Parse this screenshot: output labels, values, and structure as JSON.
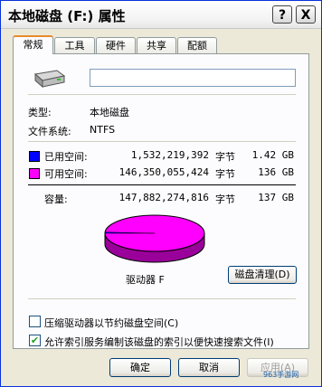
{
  "window": {
    "title": "本地磁盘 (F:) 属性",
    "help_label": "?",
    "close_label": "X"
  },
  "tabs": [
    {
      "label": "常规",
      "active": true
    },
    {
      "label": "工具",
      "active": false
    },
    {
      "label": "硬件",
      "active": false
    },
    {
      "label": "共享",
      "active": false
    },
    {
      "label": "配额",
      "active": false
    }
  ],
  "general": {
    "name_value": "",
    "type_label": "类型:",
    "type_value": "本地磁盘",
    "fs_label": "文件系统:",
    "fs_value": "NTFS",
    "used_label": "已用空间:",
    "used_bytes": "1,532,219,392",
    "used_unit": "字节",
    "used_size": "1.42 GB",
    "free_label": "可用空间:",
    "free_bytes": "146,350,055,424",
    "free_unit": "字节",
    "free_size": "136 GB",
    "capacity_label": "容量:",
    "capacity_bytes": "147,882,274,816",
    "capacity_unit": "字节",
    "capacity_size": "137 GB",
    "drive_label": "驱动器 F",
    "cleanup_button": "磁盘清理(D)",
    "used_fraction": 0.0104,
    "colors": {
      "used": "#0000ff",
      "free": "#ff00ff",
      "free_dark": "#9a009a"
    }
  },
  "options": {
    "compress_label": "压缩驱动器以节约磁盘空间(C)",
    "compress_checked": false,
    "index_label": "允许索引服务编制该磁盘的索引以便快速搜索文件(I)",
    "index_checked": true,
    "check_mark": "✔"
  },
  "buttons": {
    "ok": "确定",
    "cancel": "取消",
    "apply": "应用(A)"
  },
  "watermark": "963手游网"
}
